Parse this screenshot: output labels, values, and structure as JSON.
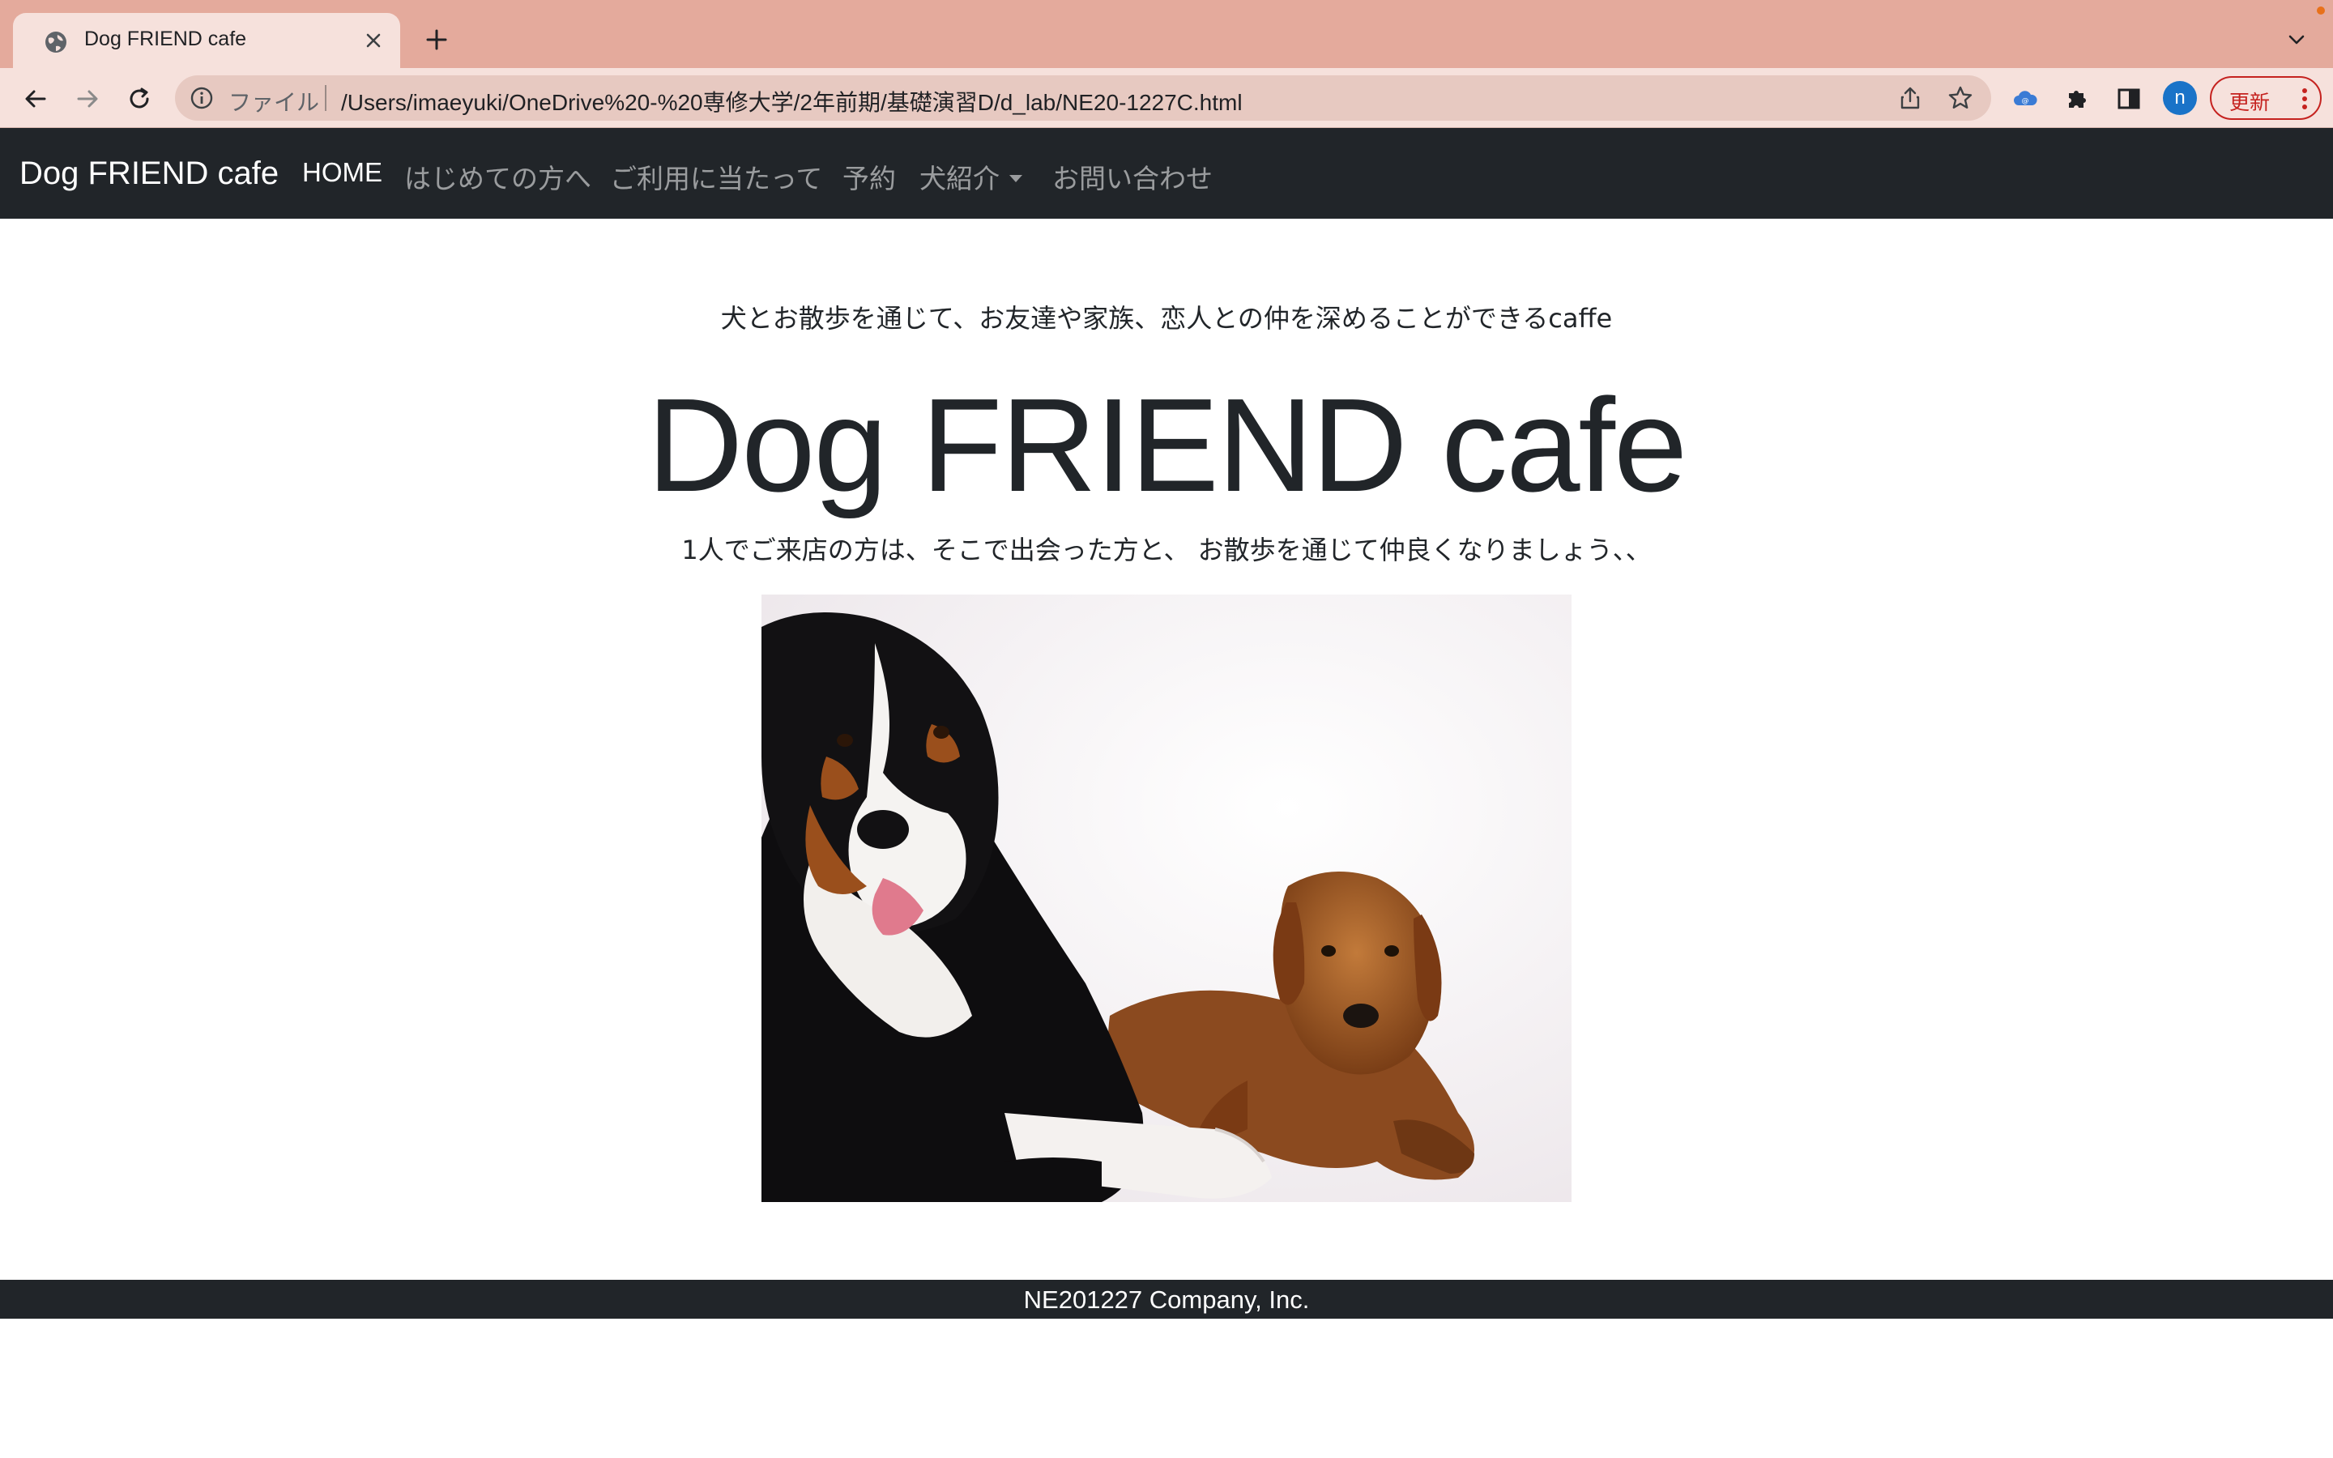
{
  "browser": {
    "tab_title": "Dog FRIEND cafe",
    "url_scheme_label": "ファイル",
    "url": "/Users/imaeyuki/OneDrive%20-%20専修大学/2年前期/基礎演習D/d_lab/NE20-1227C.html",
    "profile_initial": "n",
    "update_label": "更新",
    "accent_color": "#e4aa9c",
    "update_color": "#c5221f"
  },
  "navbar": {
    "brand": "Dog FRIEND cafe",
    "items": [
      {
        "label": "HOME"
      },
      {
        "label": "はじめての方へ"
      },
      {
        "label": "ご利用に当たって"
      },
      {
        "label": "予約"
      },
      {
        "label": "犬紹介"
      },
      {
        "label": "お問い合わせ"
      }
    ],
    "background": "#212529"
  },
  "hero": {
    "tagline": "犬とお散歩を通じて、お友達や家族、恋人との仲を深めることができるcaffe",
    "title": "Dog FRIEND cafe",
    "subtitle": "1人でご来店の方は、そこで出会った方と、 お散歩を通じて仲良くなりましょう、、",
    "image_subject": "Bernese Mountain Dog and Golden Retriever lying on a white background"
  },
  "footer": {
    "text": "NE201227 Company, Inc."
  }
}
